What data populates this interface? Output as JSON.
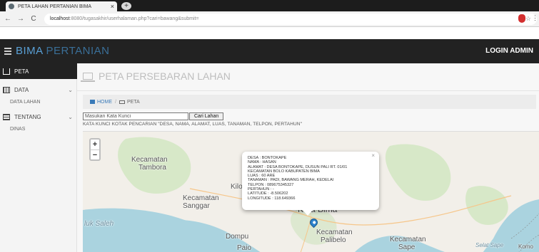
{
  "browser": {
    "tab_title": "PETA LAHAN PERTANIAN BIMA",
    "tab_close": "×",
    "new_tab": "+",
    "back": "←",
    "forward": "→",
    "reload": "C",
    "url_host": "localhost",
    "url_path": ":8080/tugasakhir/userhalaman.php?cari=bawang&submit=",
    "star": "☆",
    "menu": "⋮"
  },
  "header": {
    "brand_part1": "BIMA",
    "brand_part2": " PERTANIAN",
    "login": "LOGIN ADMIN"
  },
  "sidebar": {
    "peta": "PETA",
    "data": "DATA",
    "data_sub": "DATA LAHAN",
    "tentang": "TENTANG",
    "tentang_sub": "DINAS",
    "chevron": "⌄"
  },
  "page": {
    "title": "PETA PERSEBARAN LAHAN",
    "breadcrumb_home": "HOME",
    "breadcrumb_sep": "/",
    "breadcrumb_current": "PETA",
    "search_placeholder": "Masukan Kata Kunci",
    "search_button": "Cari Lahan",
    "hint": "KATA KUNCI KOTAK PENCARIAN \"DESA, NAMA, ALAMAT, LUAS, TANAMAN, TELPON, PERTAHUN\""
  },
  "map": {
    "zoom_in": "+",
    "zoom_out": "−",
    "places": {
      "kecamatan_tambora_1": "Kecamatan",
      "kecamatan_tambora_2": "Tambora",
      "kilo": "Kilo",
      "kecamatan_sanggar_1": "Kecamatan",
      "kecamatan_sanggar_2": "Sanggar",
      "teluk_saleh": "luk Saleh",
      "kota_bima": "Kota Bima",
      "dompu": "Dompu",
      "paio": "Paio",
      "kecamatan_palibelo_1": "Kecamatan",
      "kecamatan_palibelo_2": "Palibelo",
      "kecamatan_sape_1": "Kecamatan",
      "kecamatan_sape_2": "Sape",
      "selat_sape": "Selat Sape",
      "komodo": "Komo"
    },
    "popup": {
      "close": "×",
      "lines": [
        "DESA : BONTOKAPE",
        "NAMA : HASAN",
        "ALAMAT : DESA BONTOKAPE, DUSUN PALI RT. 01/01",
        "KECAMATAN BOLO KABUPATEN BIMA",
        "LUAS : 60 ARE",
        "TANAMAN : PADI, BAWANG MERAH, KEDELAI",
        "TELPON : 089675345327",
        "PERTAHUN : -",
        "LATITUDE : -8.506202",
        "LONGITUDE : 118.649366"
      ]
    }
  },
  "colors": {
    "water": "#aad3df",
    "land": "#f2efe9",
    "green": "#d7e8c8",
    "header_bg": "#222222",
    "brand_accent": "#5aa0d6",
    "marker": "#2b82cb"
  }
}
